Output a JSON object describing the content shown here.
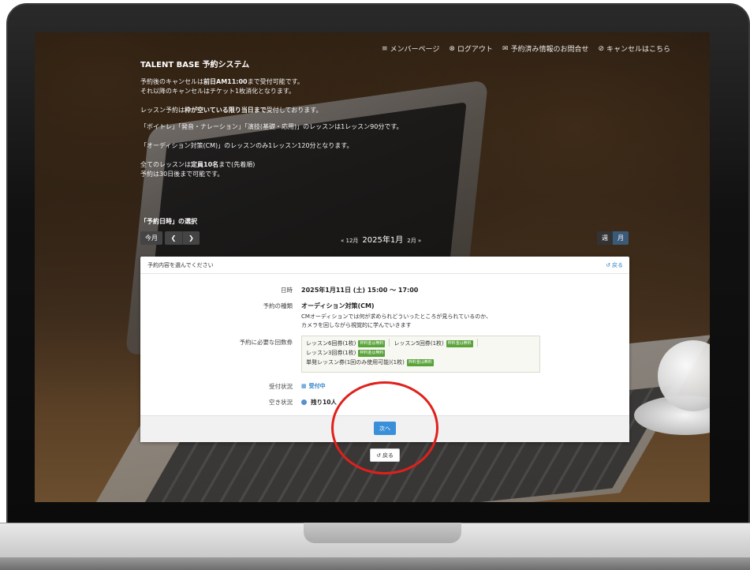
{
  "nav": {
    "member_page": "メンバーページ",
    "logout": "ログアウト",
    "reservation_inquiry": "予約済み情報のお問合せ",
    "cancel": "キャンセルはこちら"
  },
  "system_title": "TALENT BASE 予約システム",
  "info": {
    "cancel_pre": "予約後のキャンセルは",
    "cancel_bold": "前日AM11:00",
    "cancel_post": "まで受付可能です。",
    "cancel_line2": "それ以降のキャンセルはチケット1枚消化となります。",
    "lesson_pre": "レッスン予約は",
    "lesson_bold": "枠が空いている限り当日まで",
    "lesson_post": "受付しております。",
    "lesson_duration": "「ボイトレ」「発音・ナレーション」「演技(基礎・応用)」のレッスンは1レッスン90分です。",
    "audition_duration": "「オーディション対策(CM)」のレッスンのみ1レッスン120分となります。",
    "capacity_pre": "全てのレッスンは",
    "capacity_bold": "定員10名",
    "capacity_post": "まで(先着順)",
    "advance": "予約は30日後まで可能です。"
  },
  "select_label": "「予約日時」の選択",
  "calendar": {
    "today": "今月",
    "prev_icon": "chevron-left",
    "next_icon": "chevron-right",
    "prev_month": "« 12月",
    "current_month": "2025年1月",
    "next_month": "2月 »",
    "view_week": "週",
    "view_month": "月"
  },
  "panel": {
    "header_text": "予約内容を選んでください",
    "back_link": "戻る",
    "datetime_label": "日時",
    "datetime_value": "2025年1月11日 (土) 15:00 ～ 17:00",
    "type_label": "予約の種類",
    "type_value": "オーディション対策(CM)",
    "type_desc1": "CMオーディションでは何が求められどういったところが見られているのか、",
    "type_desc2": "カメラを回しながら視覚的に学んでいきます",
    "tickets_label": "予約に必要な回数券",
    "tickets": [
      {
        "name": "レッスン6回券(1枚)",
        "badge": "枠料金は無料"
      },
      {
        "name": "レッスン5回券(1枚)",
        "badge": "枠料金は無料"
      },
      {
        "name": "レッスン3回券(1枚)",
        "badge": "枠料金は無料"
      },
      {
        "name": "単発レッスン券(1回のみ使用可能)(1枚)",
        "badge": "枠料金は無料"
      }
    ],
    "status_label": "受付状況",
    "status_value": "受付中",
    "vacancy_label": "空き状況",
    "vacancy_value": "残り10人",
    "next_button": "次へ"
  },
  "back_button": "戻る",
  "colors": {
    "accent_blue": "#3a8fd9",
    "badge_green": "#5aa33a",
    "annotation_red": "#e0201b",
    "month_active": "#3b5a78"
  }
}
